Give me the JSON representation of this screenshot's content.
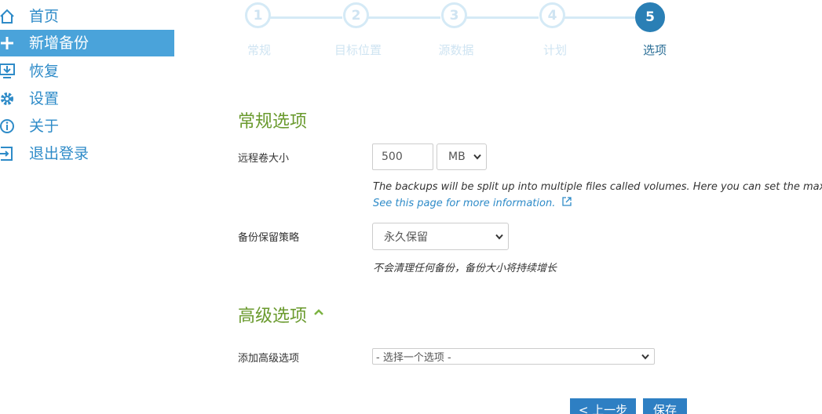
{
  "sidebar": {
    "items": [
      {
        "label": "首页",
        "icon": "home-icon",
        "active": false
      },
      {
        "label": "新增备份",
        "icon": "plus-icon",
        "active": true
      },
      {
        "label": "恢复",
        "icon": "restore-icon",
        "active": false
      },
      {
        "label": "设置",
        "icon": "gear-icon",
        "active": false
      },
      {
        "label": "关于",
        "icon": "info-icon",
        "active": false
      },
      {
        "label": "退出登录",
        "icon": "logout-icon",
        "active": false
      }
    ]
  },
  "wizard": {
    "steps": [
      {
        "number": "1",
        "label": "常规"
      },
      {
        "number": "2",
        "label": "目标位置"
      },
      {
        "number": "3",
        "label": "源数据"
      },
      {
        "number": "4",
        "label": "计划"
      },
      {
        "number": "5",
        "label": "选项"
      }
    ],
    "current_step": 5
  },
  "general": {
    "title": "常规选项",
    "volume_label": "远程卷大小",
    "volume_value": "500",
    "volume_unit": "MB",
    "volume_help": "The backups will be split up into multiple files called volumes. Here you can set the maxim",
    "volume_link": "See this page for more information.",
    "retention_label": "备份保留策略",
    "retention_value": "永久保留",
    "retention_help": "不会清理任何备份，备份大小将持续增长"
  },
  "advanced": {
    "title": "高级选项",
    "add_label": "添加高级选项",
    "add_placeholder": "- 选择一个选项 -"
  },
  "buttons": {
    "back": "< 上一步",
    "save": "保存"
  },
  "colors": {
    "accent": "#2e8bc8",
    "active_nav": "#4aa3da",
    "section_heading": "#6a9a2e",
    "button": "#2e7fc3"
  }
}
